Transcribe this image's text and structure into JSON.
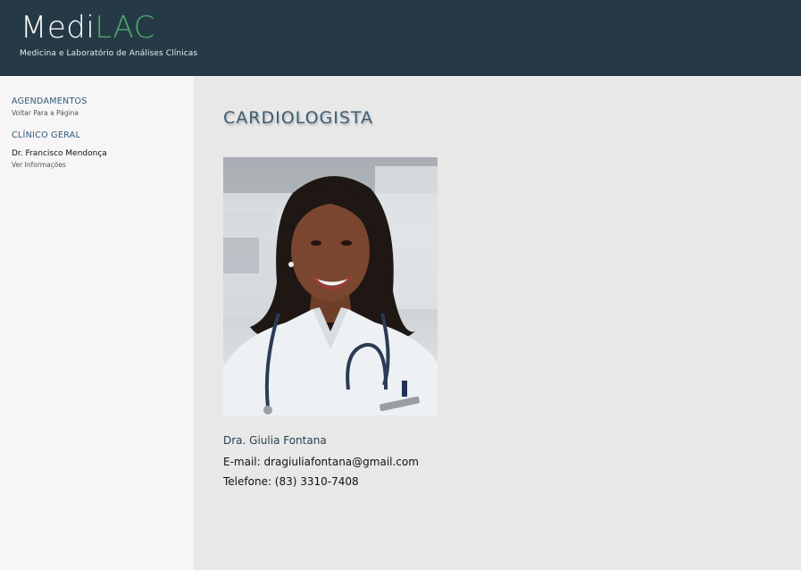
{
  "header": {
    "logo_part1": "Medi",
    "logo_part2": "LAC",
    "tagline": "Medicina e Laboratório de Análises Clínicas"
  },
  "sidebar": {
    "section1_title": "AGENDAMENTOS",
    "section1_link": "Voltar Para a Página",
    "section2_title": "CLÍNICO GERAL",
    "doctor_name": "Dr. Francisco Mendonça",
    "doctor_link": "Ver Informações"
  },
  "main": {
    "title": "CARDIOLOGISTA",
    "doctor_name": "Dra. Giulia Fontana",
    "email": "E-mail: dragiuliafontana@gmail.com",
    "phone": "Telefone: (83) 3310-7408"
  },
  "colors": {
    "header_bg": "#253a46",
    "logo_accent": "#4fa86a",
    "sidebar_bg": "#f7f5f6",
    "content_bg": "#e8e8e8",
    "title_color": "#3d5e74"
  }
}
